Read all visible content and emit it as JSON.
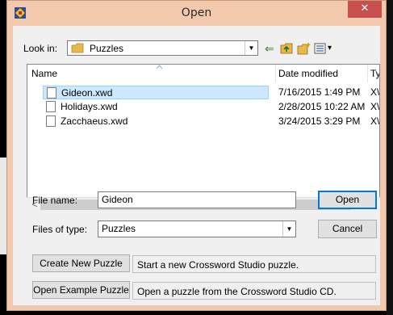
{
  "window": {
    "title": "Open",
    "close_glyph": "✕"
  },
  "look_in": {
    "label": "Look in:",
    "value": "Puzzles",
    "arrow": "▼"
  },
  "toolbar": {
    "back_glyph": "⇐",
    "overflow_glyph": "▾"
  },
  "file_list": {
    "columns": [
      "Name",
      "Date modified",
      "Ty"
    ],
    "rows": [
      {
        "name": "Gideon.xwd",
        "date": "7/16/2015 1:49 PM",
        "type": "X\\",
        "selected": true
      },
      {
        "name": "Holidays.xwd",
        "date": "2/28/2015 10:22 AM",
        "type": "X\\",
        "selected": false
      },
      {
        "name": "Zacchaeus.xwd",
        "date": "3/24/2015 3:29 PM",
        "type": "X\\",
        "selected": false
      }
    ]
  },
  "scrollbar": {
    "left_arrow": "<",
    "right_arrow": ">"
  },
  "file_name": {
    "label": "File name:",
    "value": "Gideon"
  },
  "files_of_type": {
    "label": "Files of type:",
    "value": "Puzzles",
    "arrow": "▼"
  },
  "buttons": {
    "open": "Open",
    "cancel": "Cancel",
    "create_new": "Create New Puzzle",
    "open_example": "Open Example Puzzle"
  },
  "descriptions": {
    "create_new": "Start a new Crossword Studio puzzle.",
    "open_example": "Open a puzzle from the Crossword Studio CD."
  },
  "colors": {
    "frame": "#f2c9ad",
    "close": "#c7504d",
    "selection": "#cce8ff",
    "default_border": "#0078d7"
  }
}
